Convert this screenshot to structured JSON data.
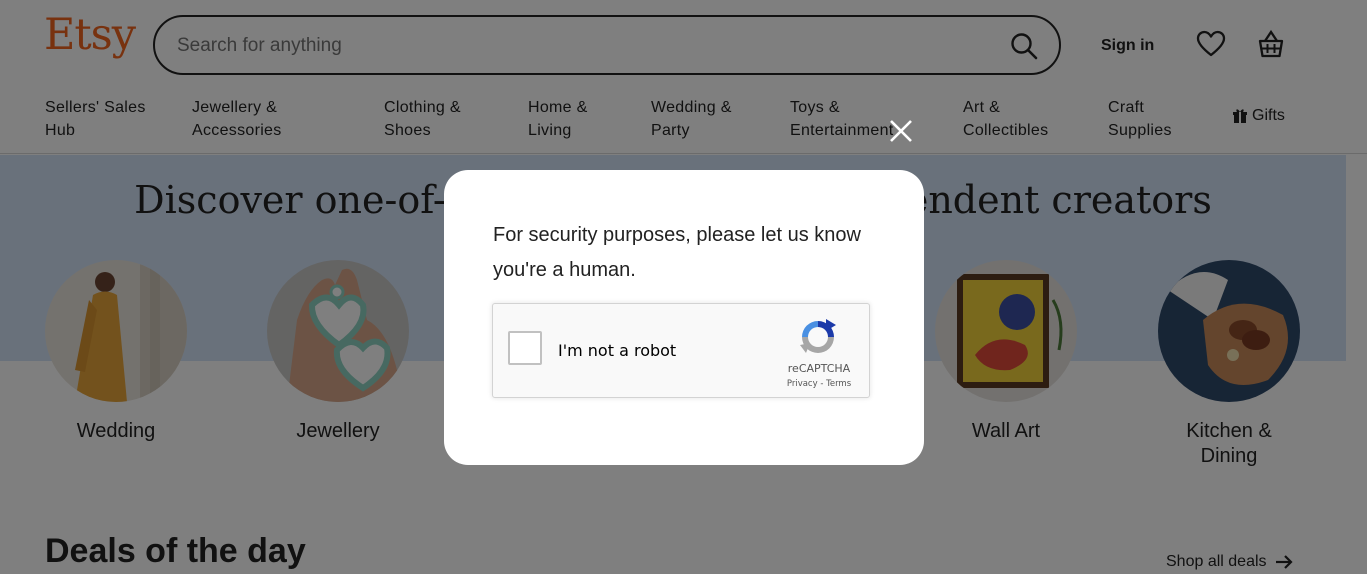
{
  "header": {
    "logo": "Etsy",
    "search_placeholder": "Search for anything",
    "signin": "Sign in",
    "icons": [
      "search-icon",
      "heart-icon",
      "shopping-basket-icon"
    ]
  },
  "nav": {
    "items": [
      {
        "label": "Sellers' Sales\nHub"
      },
      {
        "label": "Jewellery &\nAccessories"
      },
      {
        "label": "Clothing &\nShoes"
      },
      {
        "label": "Home &\nLiving"
      },
      {
        "label": "Wedding &\nParty"
      },
      {
        "label": "Toys &\nEntertainment"
      },
      {
        "label": "Art &\nCollectibles"
      },
      {
        "label": "Craft\nSupplies"
      }
    ],
    "gifts": "Gifts"
  },
  "hero": {
    "title": "Discover one-of-a-kind items from independent creators",
    "categories": [
      {
        "label": "Wedding"
      },
      {
        "label": "Jewellery"
      },
      {
        "label": "Wall Art"
      },
      {
        "label": "Kitchen &\nDining"
      }
    ]
  },
  "deals": {
    "title": "Deals of the day",
    "link": "Shop all deals"
  },
  "modal": {
    "message": "For security purposes, please let us know you're a human.",
    "captcha_label": "I'm not a robot",
    "captcha_brand": "reCAPTCHA",
    "captcha_links": "Privacy - Terms"
  },
  "colors": {
    "brand": "#f1641e",
    "hero_bg": "#d3e2f7",
    "overlay": "rgba(0,0,0,0.5)"
  }
}
